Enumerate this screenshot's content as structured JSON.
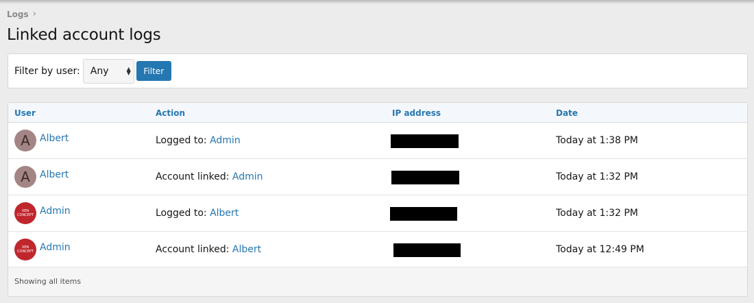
{
  "breadcrumb": {
    "label": "Logs",
    "separator": "›"
  },
  "page_title": "Linked account logs",
  "filter": {
    "label": "Filter by user:",
    "select_value": "Any",
    "button_label": "Filter"
  },
  "table": {
    "columns": [
      "User",
      "Action",
      "IP address",
      "Date"
    ],
    "rows": [
      {
        "avatar_text": "A",
        "user": "Albert",
        "action_prefix": "Logged to:",
        "action_target": "Admin",
        "date": "Today at 1:38 PM"
      },
      {
        "avatar_text": "A",
        "user": "Albert",
        "action_prefix": "Account linked:",
        "action_target": "Admin",
        "date": "Today at 1:32 PM"
      },
      {
        "avatar_text": "XEN CONCEPT",
        "user": "Admin",
        "action_prefix": "Logged to:",
        "action_target": "Albert",
        "date": "Today at 1:32 PM"
      },
      {
        "avatar_text": "XEN CONCEPT",
        "user": "Admin",
        "action_prefix": "Account linked:",
        "action_target": "Albert",
        "date": "Today at 12:49 PM"
      }
    ]
  },
  "footer": {
    "text": "Showing all items"
  },
  "colors": {
    "accent": "#2577b1",
    "avatar_a": "#a48585",
    "avatar_xen": "#c0272d"
  }
}
